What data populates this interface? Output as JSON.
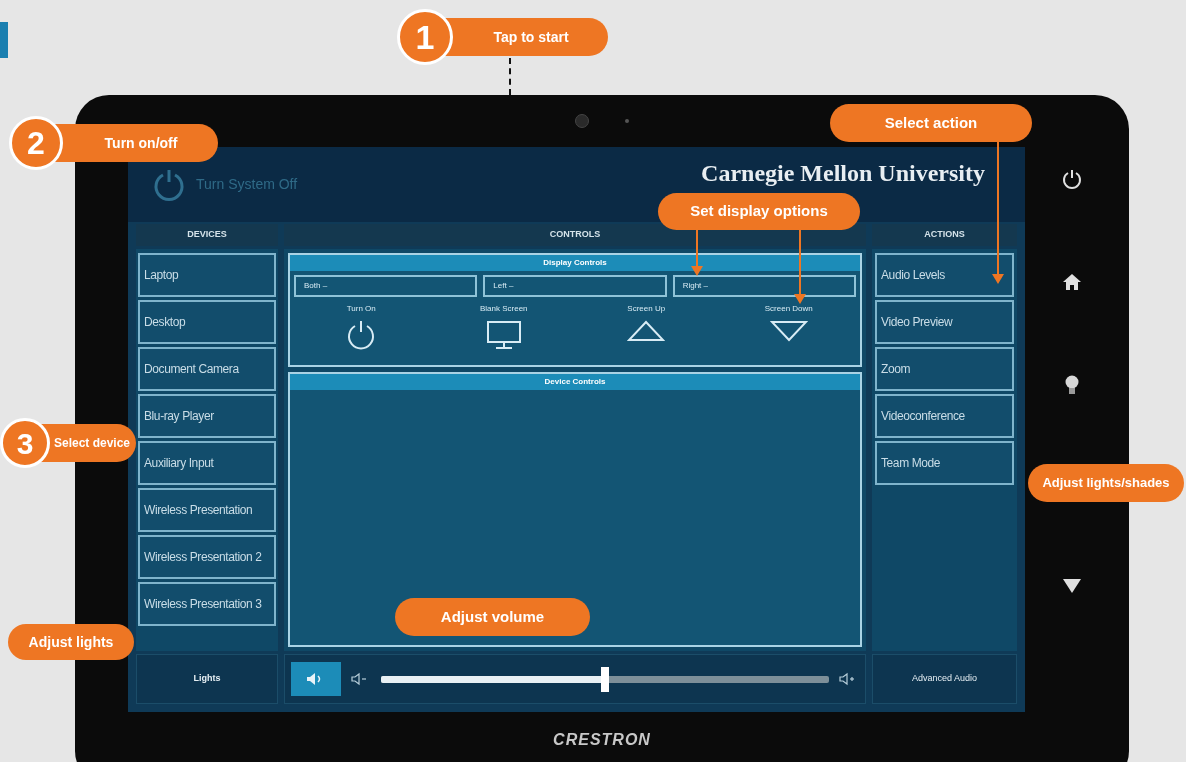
{
  "header": {
    "power_label": "Turn System Off",
    "logo_text": "Carnegie Mellon University"
  },
  "devices": {
    "title": "DEVICES",
    "items": [
      {
        "label": "Laptop",
        "selected": false
      },
      {
        "label": "Desktop",
        "selected": false
      },
      {
        "label": "Document Camera",
        "selected": false
      },
      {
        "label": "Blu-ray Player",
        "selected": false
      },
      {
        "label": "Auxiliary Input",
        "selected": false
      },
      {
        "label": "Wireless Presentation",
        "selected": false
      },
      {
        "label": "Wireless Presentation 2",
        "selected": false
      },
      {
        "label": "Wireless Presentation 3",
        "selected": false
      }
    ],
    "lights_label": "Lights"
  },
  "controls": {
    "title": "CONTROLS",
    "display_controls": {
      "title": "Display Controls",
      "dropdowns": [
        "Both –",
        "Left –",
        "Right –"
      ],
      "buttons": [
        {
          "label": "Turn On",
          "kind": "power"
        },
        {
          "label": "Blank Screen",
          "kind": "monitor"
        },
        {
          "label": "Screen Up",
          "kind": "up"
        },
        {
          "label": "Screen Down",
          "kind": "down"
        }
      ]
    },
    "device_controls": {
      "title": "Device Controls"
    },
    "volume": {
      "level": 0.5
    }
  },
  "actions": {
    "title": "ACTIONS",
    "items": [
      {
        "label": "Audio Levels",
        "selected": false
      },
      {
        "label": "Video Preview",
        "selected": false
      },
      {
        "label": "Zoom",
        "selected": false
      },
      {
        "label": "Videoconference",
        "selected": false
      },
      {
        "label": "Team Mode",
        "selected": false
      }
    ],
    "advanced_label": "Advanced Audio"
  },
  "brand": "CRESTRON",
  "numbered_callouts": [
    {
      "number": "1",
      "text": "Tap to start"
    },
    {
      "number": "2",
      "text": "Turn on/off"
    },
    {
      "number": "3",
      "text": "Select device"
    }
  ],
  "callouts": [
    {
      "text": "Select action"
    },
    {
      "text": "Set display options"
    },
    {
      "text": "Adjust lights"
    },
    {
      "text": "Adjust volume"
    },
    {
      "text": "Adjust lights/shades"
    }
  ]
}
